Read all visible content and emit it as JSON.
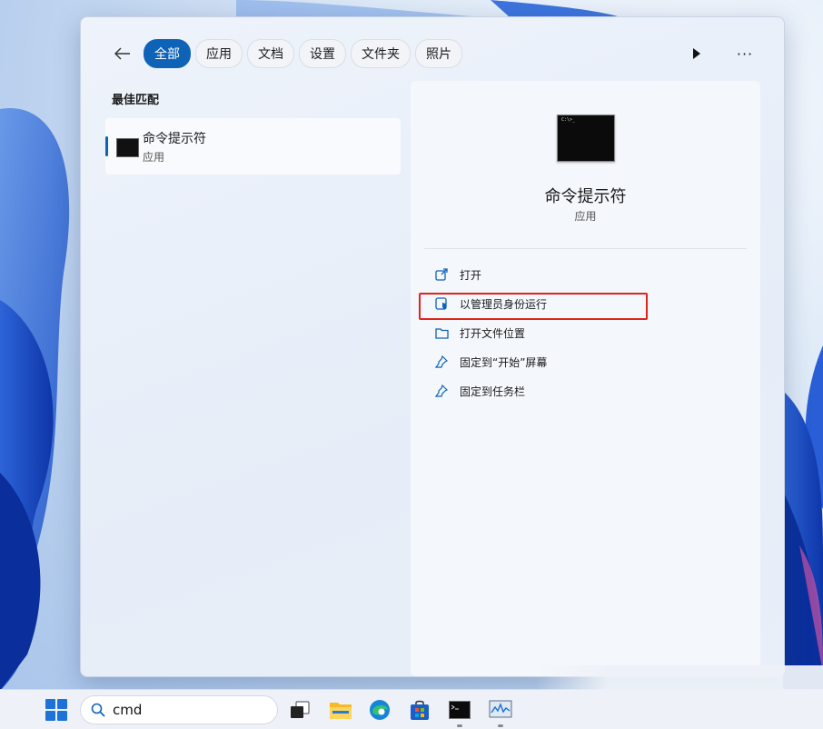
{
  "search_panel": {
    "tabs": [
      {
        "label": "全部",
        "active": true
      },
      {
        "label": "应用",
        "active": false
      },
      {
        "label": "文档",
        "active": false
      },
      {
        "label": "设置",
        "active": false
      },
      {
        "label": "文件夹",
        "active": false
      },
      {
        "label": "照片",
        "active": false
      }
    ],
    "icons": {
      "back": "back-arrow-icon",
      "play": "play-icon",
      "more": "more-icon"
    },
    "more_label": "···",
    "best_match": {
      "section_title": "最佳匹配",
      "name": "命令提示符",
      "type": "应用",
      "icon": "command-prompt-icon"
    },
    "detail": {
      "name": "命令提示符",
      "type": "应用",
      "icon": "command-prompt-icon",
      "prompt_text": "C:\\>_",
      "actions": [
        {
          "label": "打开",
          "icon": "open-external-icon"
        },
        {
          "label": "以管理员身份运行",
          "icon": "admin-shield-icon",
          "highlighted": true
        },
        {
          "label": "打开文件位置",
          "icon": "folder-icon"
        },
        {
          "label": "固定到“开始”屏幕",
          "icon": "pin-icon"
        },
        {
          "label": "固定到任务栏",
          "icon": "pin-icon"
        }
      ]
    }
  },
  "taskbar": {
    "search_value": "cmd",
    "apps": [
      "start-icon",
      "task-view-icon",
      "file-explorer-icon",
      "edge-icon",
      "store-icon",
      "command-prompt-icon",
      "performance-monitor-icon"
    ]
  },
  "colors": {
    "accent": "#0f63b7",
    "highlight_border": "#e0241b"
  }
}
